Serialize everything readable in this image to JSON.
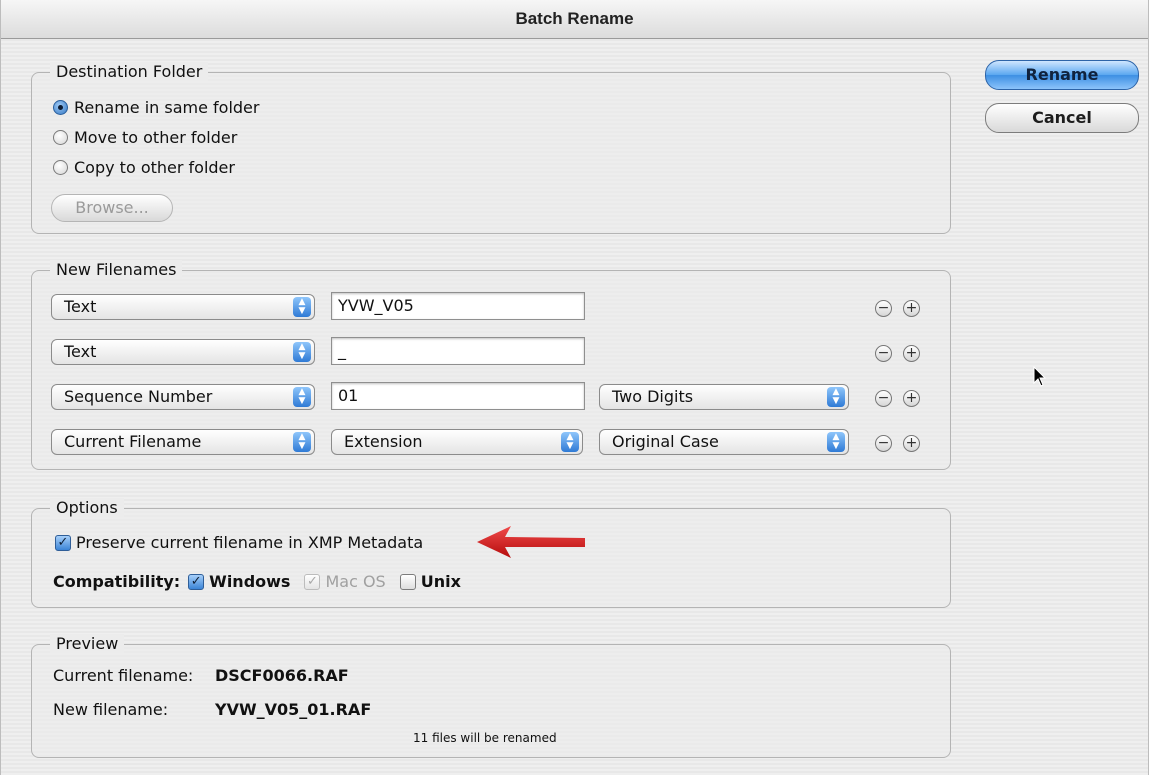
{
  "window": {
    "title": "Batch Rename"
  },
  "buttons": {
    "rename": "Rename",
    "cancel": "Cancel",
    "browse": "Browse..."
  },
  "destination": {
    "label": "Destination Folder",
    "options": [
      "Rename in same folder",
      "Move to other folder",
      "Copy to other folder"
    ],
    "selected_index": 0
  },
  "new_filenames": {
    "label": "New Filenames",
    "rows": [
      {
        "type": "Text",
        "value": "YVW_V05"
      },
      {
        "type": "Text",
        "value": "_"
      },
      {
        "type": "Sequence Number",
        "value": "01",
        "format": "Two Digits"
      },
      {
        "type": "Current Filename",
        "part": "Extension",
        "case": "Original Case"
      }
    ],
    "minus_symbol": "−",
    "plus_symbol": "+"
  },
  "options": {
    "label": "Options",
    "preserve_label": "Preserve current filename in XMP Metadata",
    "preserve_checked": true,
    "compat_label": "Compatibility:",
    "compat": [
      {
        "label": "Windows",
        "checked": true,
        "enabled": true
      },
      {
        "label": "Mac OS",
        "checked": true,
        "enabled": false
      },
      {
        "label": "Unix",
        "checked": false,
        "enabled": true
      }
    ],
    "check_mark": "✓"
  },
  "preview": {
    "label": "Preview",
    "current_label": "Current filename:",
    "current_value": "DSCF0066.RAF",
    "new_label": "New filename:",
    "new_value": "YVW_V05_01.RAF",
    "note": "11 files will be renamed"
  },
  "colors": {
    "accent_blue": "#3d8fe3",
    "annotation_red": "#d11a1a"
  },
  "icons": {
    "popup_arrows": "updown-arrows-icon",
    "cursor": "mouse-pointer-icon"
  }
}
